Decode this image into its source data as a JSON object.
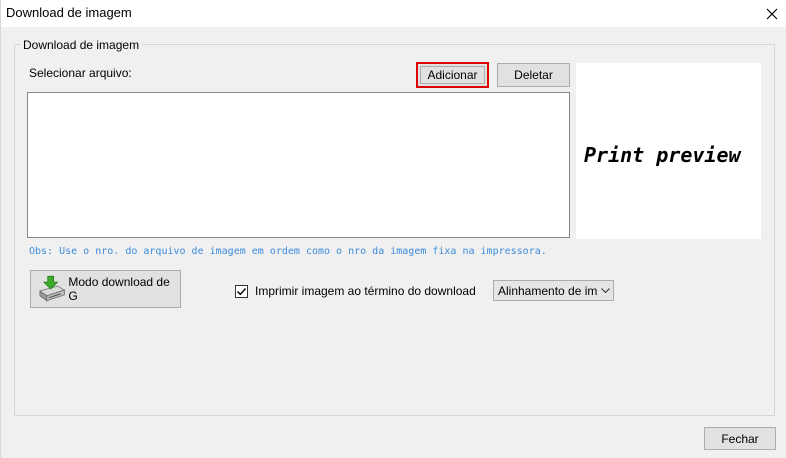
{
  "window": {
    "title": "Download de imagem",
    "close_icon": "close-icon"
  },
  "group": {
    "legend": "Download de imagem",
    "select_label": "Selecionar arquivo:",
    "add_label": "Adicionar",
    "delete_label": "Deletar",
    "file_list": [],
    "preview_text": "Print preview",
    "note": "Obs: Use o nro. do arquivo de imagem em ordem como o nro da imagem fixa na impressora.",
    "mode_button_label": "Modo download de G",
    "mode_button_icon": "printer-download-icon",
    "print_after_download_label": "Imprimir imagem ao término do download",
    "print_after_download_checked": true,
    "alignment_select_value": "Alinhamento de impre"
  },
  "footer": {
    "close_label": "Fechar"
  },
  "colors": {
    "highlight_border": "#e00000",
    "note_text": "#3c8cdc",
    "button_face": "#e1e1e1",
    "window_bg": "#f0f0f0"
  }
}
